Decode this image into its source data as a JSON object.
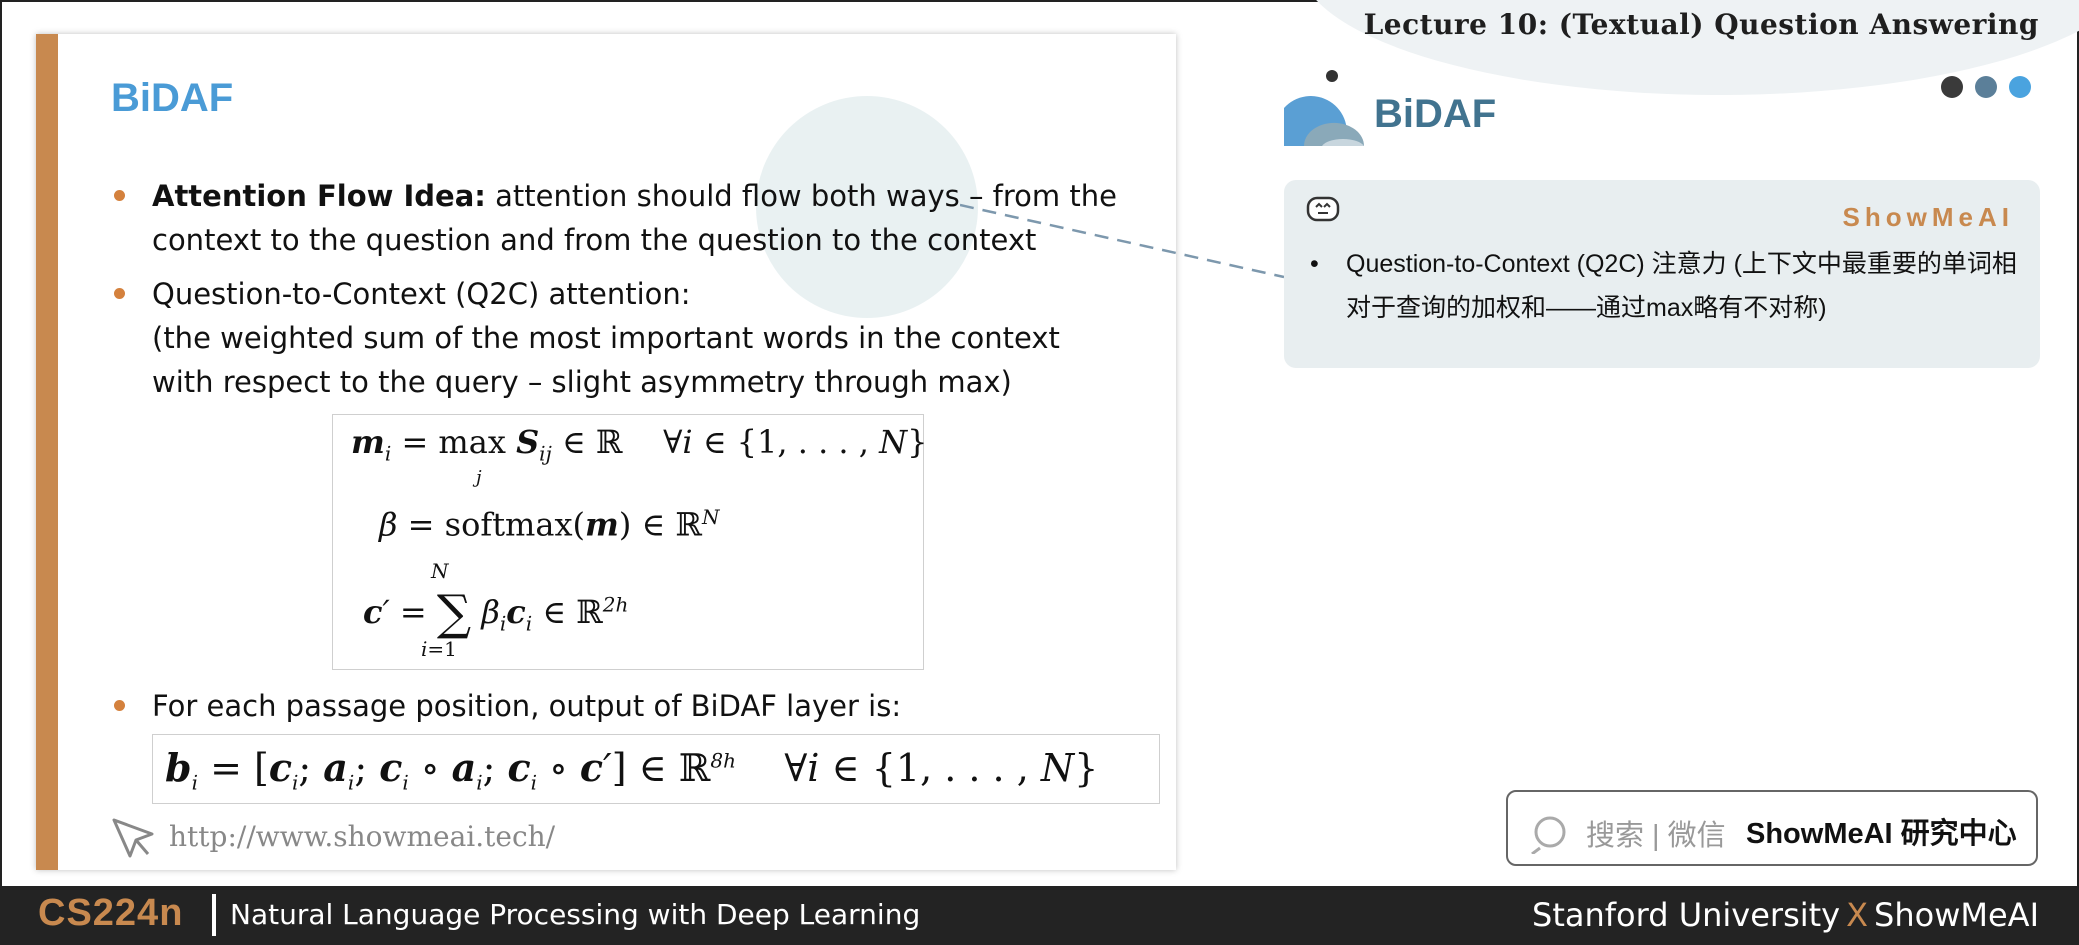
{
  "header": {
    "lecture_title": "Lecture 10: (Textual) Question Answering",
    "dot_colors": [
      "#3a3a3a",
      "#5b7f99",
      "#4aa3df"
    ]
  },
  "slide": {
    "title": "BiDAF",
    "bullets": [
      {
        "bold": "Attention Flow Idea:",
        "line1": " attention should flow both ways – from the",
        "line2": "context to the question and from the question to the context"
      },
      {
        "line1": "Question-to-Context (Q2C) attention:",
        "line2": "(the weighted sum of the most important words in the context",
        "line3": "with respect to the query – slight asymmetry through max)"
      },
      {
        "line1": "For each passage position, output of BiDAF layer is:"
      }
    ],
    "url": "http://www.showmeai.tech/",
    "accent_color": "#c8894f",
    "title_color": "#4a9bd6"
  },
  "right_panel": {
    "title": "BiDAF",
    "brand": "ShowMeAI",
    "note": "Question-to-Context (Q2C) 注意力 (上下文中最重要的单词相对于查询的加权和——通过max略有不对称)",
    "search_label": "搜索 | 微信",
    "search_brand": "ShowMeAI 研究中心"
  },
  "footer": {
    "course": "CS224n",
    "course_title": "Natural Language Processing with Deep Learning",
    "university": "Stanford University",
    "x": "X",
    "brand": "ShowMeAI"
  }
}
